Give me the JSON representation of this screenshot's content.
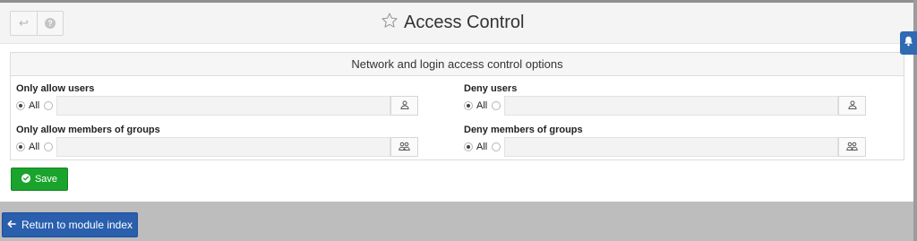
{
  "header": {
    "title": "Access Control",
    "back_icon": "↩",
    "help_icon": "?",
    "star_icon": "star-outline-icon"
  },
  "notification": {
    "icon": "bell-icon",
    "color": "#2f6ab3"
  },
  "options": {
    "heading": "Network and login access control options",
    "fields": [
      {
        "label": "Only allow users",
        "radio_all": "All",
        "selected": "All",
        "value": "",
        "picker_icon": "user-icon"
      },
      {
        "label": "Deny users",
        "radio_all": "All",
        "selected": "All",
        "value": "",
        "picker_icon": "user-icon"
      },
      {
        "label": "Only allow members of groups",
        "radio_all": "All",
        "selected": "All",
        "value": "",
        "picker_icon": "group-icon"
      },
      {
        "label": "Deny members of groups",
        "radio_all": "All",
        "selected": "All",
        "value": "",
        "picker_icon": "group-icon"
      }
    ]
  },
  "buttons": {
    "save_label": "Save",
    "return_label": "Return to module index"
  },
  "colors": {
    "save": "#1aa32d",
    "return": "#2a5fae",
    "accent": "#2f6ab3",
    "background": "#bdbdbd"
  }
}
